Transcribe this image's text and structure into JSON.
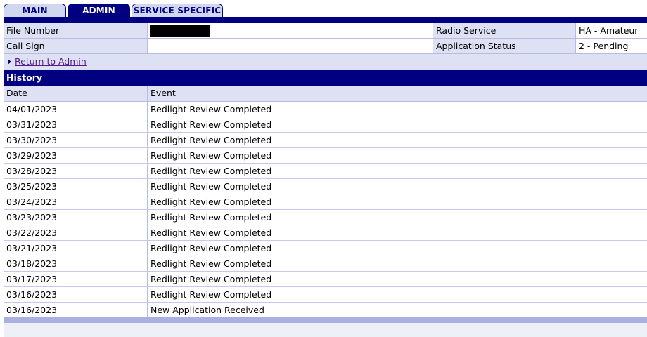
{
  "tabs": {
    "main": "MAIN",
    "admin": "ADMIN",
    "service_specific": "SERVICE SPECIFIC"
  },
  "info": {
    "file_number_label": "File Number",
    "file_number_value": "",
    "radio_service_label": "Radio Service",
    "radio_service_value": "HA - Amateur",
    "call_sign_label": "Call Sign",
    "call_sign_value": "",
    "application_status_label": "Application Status",
    "application_status_value": "2 - Pending"
  },
  "return_link": "Return to Admin",
  "history": {
    "title": "History",
    "columns": {
      "date": "Date",
      "event": "Event"
    },
    "rows": [
      {
        "date": "04/01/2023",
        "event": "Redlight Review Completed"
      },
      {
        "date": "03/31/2023",
        "event": "Redlight Review Completed"
      },
      {
        "date": "03/30/2023",
        "event": "Redlight Review Completed"
      },
      {
        "date": "03/29/2023",
        "event": "Redlight Review Completed"
      },
      {
        "date": "03/28/2023",
        "event": "Redlight Review Completed"
      },
      {
        "date": "03/25/2023",
        "event": "Redlight Review Completed"
      },
      {
        "date": "03/24/2023",
        "event": "Redlight Review Completed"
      },
      {
        "date": "03/23/2023",
        "event": "Redlight Review Completed"
      },
      {
        "date": "03/22/2023",
        "event": "Redlight Review Completed"
      },
      {
        "date": "03/21/2023",
        "event": "Redlight Review Completed"
      },
      {
        "date": "03/18/2023",
        "event": "Redlight Review Completed"
      },
      {
        "date": "03/17/2023",
        "event": "Redlight Review Completed"
      },
      {
        "date": "03/16/2023",
        "event": "Redlight Review Completed"
      },
      {
        "date": "03/16/2023",
        "event": "New Application Received"
      }
    ]
  },
  "colors": {
    "navy": "#000080",
    "label_bg": "#dde1f3",
    "tab_inactive_bg": "#d2d7f0",
    "link": "#551a8b",
    "redaction": "#000000"
  },
  "icons": {
    "return_arrow": "triangle-right-icon"
  }
}
